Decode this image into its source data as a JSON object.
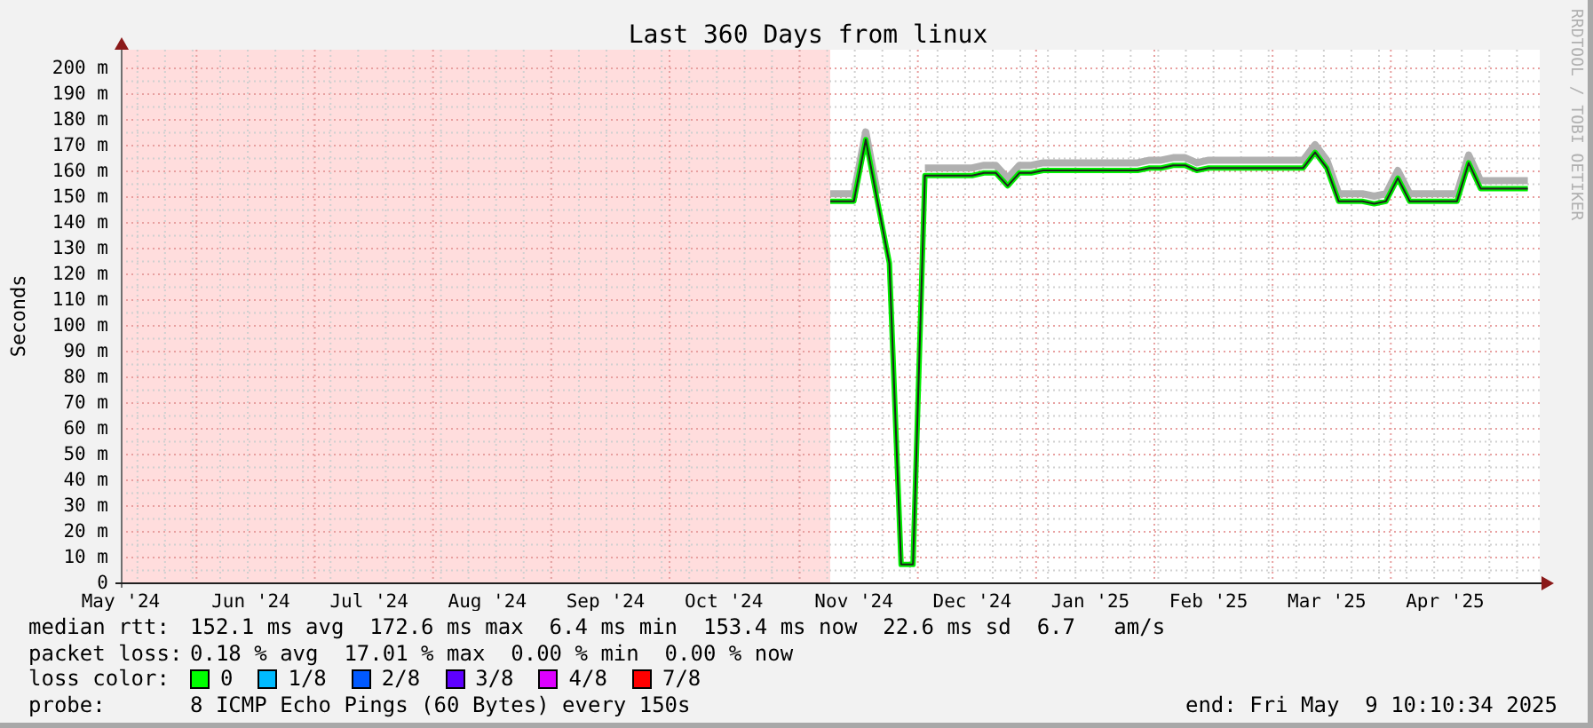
{
  "title": "Last 360 Days from linux",
  "credit": "RRDTOOL / TOBI OETIKER",
  "chart_data": {
    "type": "line",
    "ylabel": "Seconds",
    "ylim": [
      0,
      200
    ],
    "grid": true,
    "categories": [
      "May '24",
      null,
      null,
      null,
      null,
      null,
      null,
      null,
      null,
      null,
      null,
      "Jun '24",
      null,
      null,
      null,
      null,
      null,
      null,
      null,
      null,
      null,
      "Jul '24",
      null,
      null,
      null,
      null,
      null,
      null,
      null,
      null,
      null,
      "Aug '24",
      null,
      null,
      null,
      null,
      null,
      null,
      null,
      null,
      null,
      "Sep '24",
      null,
      null,
      null,
      null,
      null,
      null,
      null,
      null,
      null,
      "Oct '24",
      null,
      null,
      null,
      null,
      null,
      null,
      null,
      null,
      null,
      null,
      "Nov '24",
      null,
      null,
      null,
      null,
      null,
      null,
      null,
      null,
      null,
      "Dec '24",
      null,
      null,
      null,
      null,
      null,
      null,
      null,
      null,
      null,
      "Jan '25",
      null,
      null,
      null,
      null,
      null,
      null,
      null,
      null,
      null,
      "Feb '25",
      null,
      null,
      null,
      null,
      null,
      null,
      null,
      null,
      null,
      "Mar '25",
      null,
      null,
      null,
      null,
      null,
      null,
      null,
      null,
      null,
      "Apr '25",
      null,
      null,
      null,
      null,
      null,
      null,
      null
    ],
    "series": [
      {
        "color": "#b0b0b0",
        "values": [
          null,
          null,
          null,
          null,
          null,
          null,
          null,
          null,
          null,
          null,
          null,
          null,
          null,
          null,
          null,
          null,
          null,
          null,
          null,
          null,
          null,
          null,
          null,
          null,
          null,
          null,
          null,
          null,
          null,
          null,
          null,
          null,
          null,
          null,
          null,
          null,
          null,
          null,
          null,
          null,
          null,
          null,
          null,
          null,
          null,
          null,
          null,
          null,
          null,
          null,
          null,
          null,
          null,
          null,
          null,
          null,
          null,
          null,
          null,
          null,
          151,
          151,
          151,
          175,
          151,
          null,
          null,
          null,
          161,
          161,
          161,
          161,
          161,
          162,
          162,
          157,
          162,
          162,
          163,
          163,
          163,
          163,
          163,
          163,
          163,
          163,
          163,
          164,
          164,
          165,
          165,
          163,
          164,
          164,
          164,
          164,
          164,
          164,
          164,
          164,
          164,
          170,
          164,
          151,
          151,
          151,
          150,
          151,
          160,
          151,
          151,
          151,
          151,
          151,
          166,
          156,
          156,
          156,
          156,
          156
        ]
      },
      {
        "color": "#00ee00",
        "values": [
          null,
          null,
          null,
          null,
          null,
          null,
          null,
          null,
          null,
          null,
          null,
          null,
          null,
          null,
          null,
          null,
          null,
          null,
          null,
          null,
          null,
          null,
          null,
          null,
          null,
          null,
          null,
          null,
          null,
          null,
          null,
          null,
          null,
          null,
          null,
          null,
          null,
          null,
          null,
          null,
          null,
          null,
          null,
          null,
          null,
          null,
          null,
          null,
          null,
          null,
          null,
          null,
          null,
          null,
          null,
          null,
          null,
          null,
          null,
          null,
          148,
          148,
          148,
          172,
          148,
          124,
          7,
          7,
          158,
          158,
          158,
          158,
          158,
          159,
          159,
          154,
          159,
          159,
          160,
          160,
          160,
          160,
          160,
          160,
          160,
          160,
          160,
          161,
          161,
          162,
          162,
          160,
          161,
          161,
          161,
          161,
          161,
          161,
          161,
          161,
          161,
          167,
          161,
          148,
          148,
          148,
          147,
          148,
          157,
          148,
          148,
          148,
          148,
          148,
          163,
          153,
          153,
          153,
          153,
          153
        ]
      }
    ],
    "yticks": [
      {
        "value": 0,
        "label": "0"
      },
      {
        "value": 10,
        "label": "10 m"
      },
      {
        "value": 20,
        "label": "20 m"
      },
      {
        "value": 30,
        "label": "30 m"
      },
      {
        "value": 40,
        "label": "40 m"
      },
      {
        "value": 50,
        "label": "50 m"
      },
      {
        "value": 60,
        "label": "60 m"
      },
      {
        "value": 70,
        "label": "70 m"
      },
      {
        "value": 80,
        "label": "80 m"
      },
      {
        "value": 90,
        "label": "90 m"
      },
      {
        "value": 100,
        "label": "100 m"
      },
      {
        "value": 110,
        "label": "110 m"
      },
      {
        "value": 120,
        "label": "120 m"
      },
      {
        "value": 130,
        "label": "130 m"
      },
      {
        "value": 140,
        "label": "140 m"
      },
      {
        "value": 150,
        "label": "150 m"
      },
      {
        "value": 160,
        "label": "160 m"
      },
      {
        "value": 170,
        "label": "170 m"
      },
      {
        "value": 180,
        "label": "180 m"
      },
      {
        "value": 190,
        "label": "190 m"
      },
      {
        "value": 200,
        "label": "200 m"
      }
    ]
  },
  "stats": [
    {
      "label": "median rtt:",
      "text": "152.1 ms avg  172.6 ms max  6.4 ms min  153.4 ms now  22.6 ms sd  6.7   am/s"
    },
    {
      "label": "packet loss:",
      "text": "0.18 % avg  17.01 % max  0.00 % min  0.00 % now"
    }
  ],
  "loss_legend": {
    "label": "loss color:",
    "items": [
      {
        "label": "0",
        "color": "#00ff00"
      },
      {
        "label": "1/8",
        "color": "#00bbff"
      },
      {
        "label": "2/8",
        "color": "#0059ff"
      },
      {
        "label": "3/8",
        "color": "#5e00ff"
      },
      {
        "label": "4/8",
        "color": "#dd00ff"
      },
      {
        "label": "7/8",
        "color": "#ff0000"
      }
    ]
  },
  "probe": {
    "label": "probe:",
    "text": "8 ICMP Echo Pings (60 Bytes) every 150s"
  },
  "end": "end: Fri May  9 10:10:34 2025"
}
